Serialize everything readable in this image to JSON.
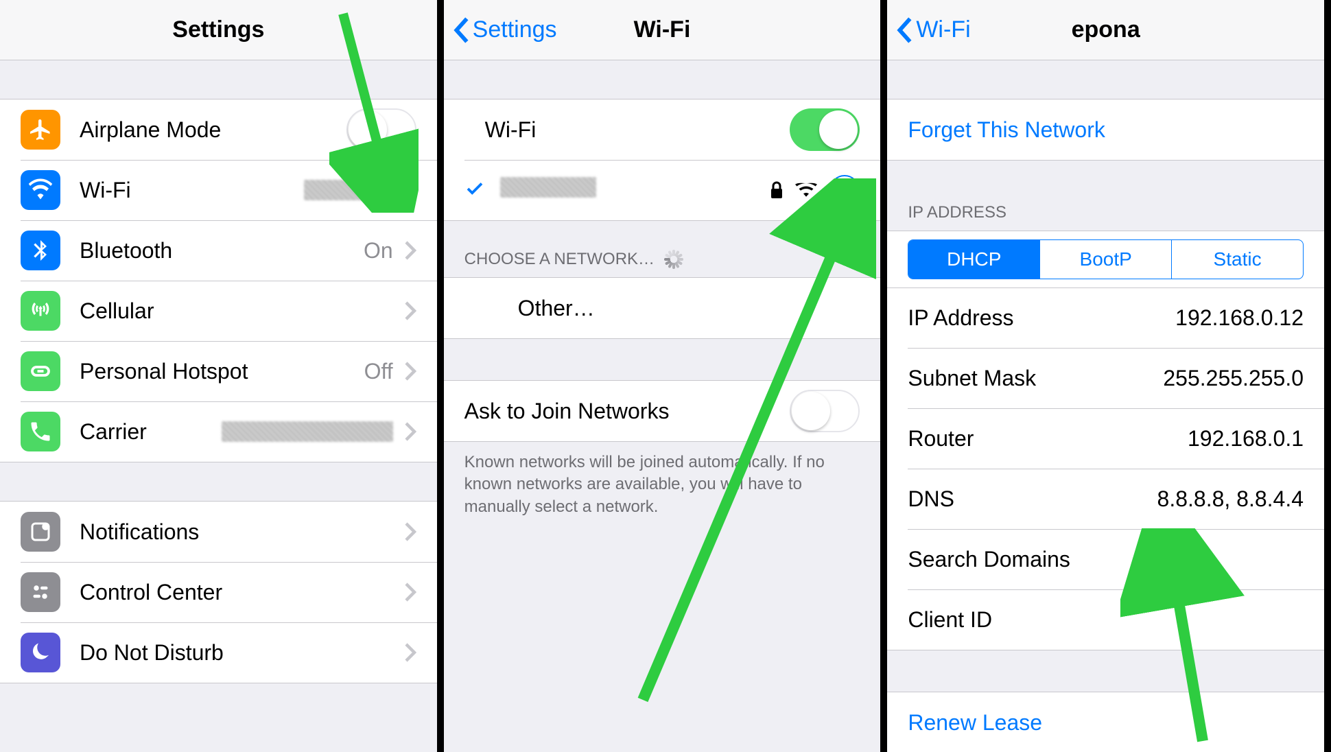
{
  "colors": {
    "airplane": "#ff9500",
    "wifi": "#007aff",
    "bluetooth": "#007aff",
    "cellular": "#4cd964",
    "hotspot": "#4cd964",
    "carrier": "#4cd964",
    "notifications": "#8e8e93",
    "controlcenter": "#8e8e93",
    "dnd": "#5856d6"
  },
  "screen1": {
    "title": "Settings",
    "group1": [
      {
        "icon": "airplane-icon",
        "label": "Airplane Mode",
        "type": "toggle",
        "on": false
      },
      {
        "icon": "wifi-icon",
        "label": "Wi-Fi",
        "type": "detail-redacted"
      },
      {
        "icon": "bluetooth-icon",
        "label": "Bluetooth",
        "type": "detail",
        "detail": "On"
      },
      {
        "icon": "cellular-icon",
        "label": "Cellular",
        "type": "nav"
      },
      {
        "icon": "hotspot-icon",
        "label": "Personal Hotspot",
        "type": "detail",
        "detail": "Off"
      },
      {
        "icon": "phone-icon",
        "label": "Carrier",
        "type": "detail-redacted-wide"
      }
    ],
    "group2": [
      {
        "icon": "notifications-icon",
        "label": "Notifications",
        "type": "nav"
      },
      {
        "icon": "controlcenter-icon",
        "label": "Control Center",
        "type": "nav"
      },
      {
        "icon": "moon-icon",
        "label": "Do Not Disturb",
        "type": "nav"
      }
    ]
  },
  "screen2": {
    "back": "Settings",
    "title": "Wi-Fi",
    "wifi_label": "Wi-Fi",
    "wifi_on": true,
    "connected_network_redacted": true,
    "choose_header": "CHOOSE A NETWORK…",
    "other": "Other…",
    "ask_label": "Ask to Join Networks",
    "ask_on": false,
    "footer": "Known networks will be joined automatically. If no known networks are available, you will have to manually select a network."
  },
  "screen3": {
    "back": "Wi-Fi",
    "title": "epona",
    "forget": "Forget This Network",
    "ip_header": "IP ADDRESS",
    "segments": [
      "DHCP",
      "BootP",
      "Static"
    ],
    "selected_segment": 0,
    "rows": [
      {
        "label": "IP Address",
        "value": "192.168.0.12"
      },
      {
        "label": "Subnet Mask",
        "value": "255.255.255.0"
      },
      {
        "label": "Router",
        "value": "192.168.0.1"
      },
      {
        "label": "DNS",
        "value": "8.8.8.8, 8.8.4.4"
      },
      {
        "label": "Search Domains",
        "value": ""
      },
      {
        "label": "Client ID",
        "value": ""
      }
    ],
    "renew": "Renew Lease"
  }
}
